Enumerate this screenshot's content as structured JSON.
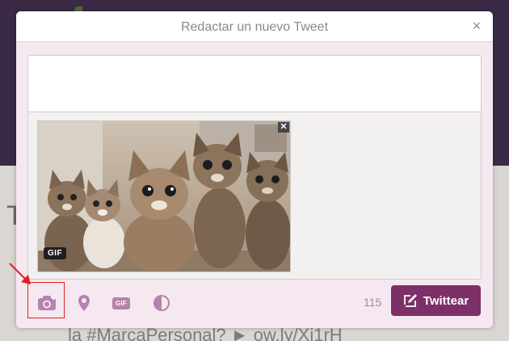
{
  "modal": {
    "title": "Redactar un nuevo Tweet",
    "close_label": "×"
  },
  "compose": {
    "text_value": "",
    "media": {
      "badge": "GIF",
      "remove_label": "✕"
    }
  },
  "toolbar": {
    "icons": [
      "camera-icon",
      "location-pin-icon",
      "gif-icon",
      "poll-icon"
    ],
    "gif_label": "GIF",
    "char_count": "115",
    "tweet_label": "Twittear"
  },
  "background": {
    "letter": "T",
    "snippet": "la #MarcaPersonal? ► ow.ly/Xi1rH"
  },
  "colors": {
    "accent": "#7c3067",
    "icon": "#b583ab",
    "annotation": "#e02020"
  }
}
